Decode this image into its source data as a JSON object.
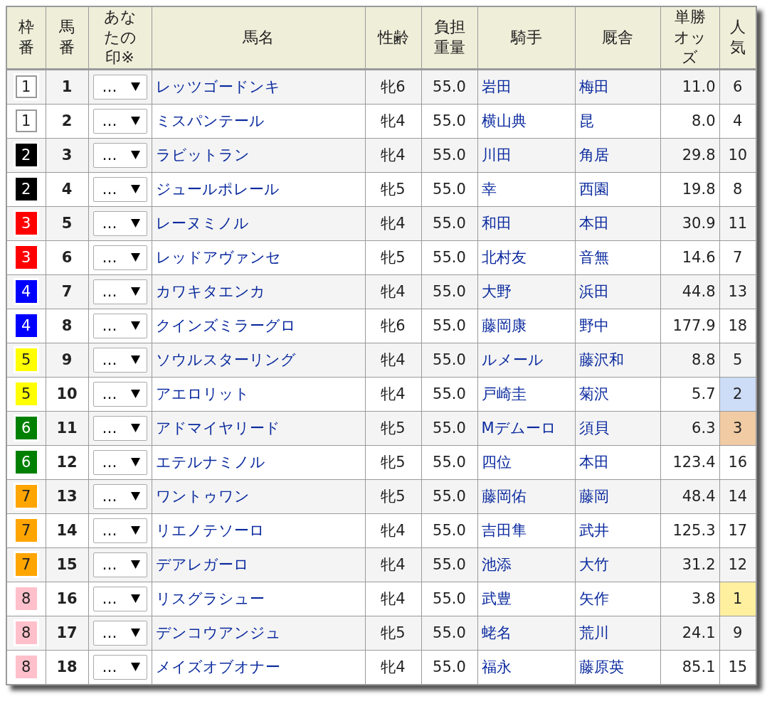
{
  "table": {
    "columns": [
      "枠番",
      "馬番",
      "あなたの印※",
      "馬名",
      "性齢",
      "負担重量",
      "騎手",
      "厩舎",
      "単勝オッズ",
      "人気"
    ],
    "rows": [
      {
        "frame": {
          "number": "1",
          "color": "#ffffff"
        },
        "horse_number": "1",
        "mark": "…",
        "horse": "レッツゴードンキ",
        "sex_age": "牝6",
        "weight": "55.0",
        "jockey": "岩田",
        "trainer": "梅田",
        "odds": "11.0",
        "popularity": {
          "text": "6"
        }
      },
      {
        "frame": {
          "number": "1",
          "color": "#ffffff"
        },
        "horse_number": "2",
        "mark": "…",
        "horse": "ミスパンテール",
        "sex_age": "牝4",
        "weight": "55.0",
        "jockey": "横山典",
        "trainer": "昆",
        "odds": "8.0",
        "popularity": {
          "text": "4"
        }
      },
      {
        "frame": {
          "number": "2",
          "color": "#000000"
        },
        "horse_number": "3",
        "mark": "…",
        "horse": "ラビットラン",
        "sex_age": "牝4",
        "weight": "55.0",
        "jockey": "川田",
        "trainer": "角居",
        "odds": "29.8",
        "popularity": {
          "text": "10"
        }
      },
      {
        "frame": {
          "number": "2",
          "color": "#000000"
        },
        "horse_number": "4",
        "mark": "…",
        "horse": "ジュールポレール",
        "sex_age": "牝5",
        "weight": "55.0",
        "jockey": "幸",
        "trainer": "西園",
        "odds": "19.8",
        "popularity": {
          "text": "8"
        }
      },
      {
        "frame": {
          "number": "3",
          "color": "#ff0000"
        },
        "horse_number": "5",
        "mark": "…",
        "horse": "レーヌミノル",
        "sex_age": "牝4",
        "weight": "55.0",
        "jockey": "和田",
        "trainer": "本田",
        "odds": "30.9",
        "popularity": {
          "text": "11"
        }
      },
      {
        "frame": {
          "number": "3",
          "color": "#ff0000"
        },
        "horse_number": "6",
        "mark": "…",
        "horse": "レッドアヴァンセ",
        "sex_age": "牝5",
        "weight": "55.0",
        "jockey": "北村友",
        "trainer": "音無",
        "odds": "14.6",
        "popularity": {
          "text": "7"
        }
      },
      {
        "frame": {
          "number": "4",
          "color": "#0000ff"
        },
        "horse_number": "7",
        "mark": "…",
        "horse": "カワキタエンカ",
        "sex_age": "牝4",
        "weight": "55.0",
        "jockey": "大野",
        "trainer": "浜田",
        "odds": "44.8",
        "popularity": {
          "text": "13"
        }
      },
      {
        "frame": {
          "number": "4",
          "color": "#0000ff"
        },
        "horse_number": "8",
        "mark": "…",
        "horse": "クインズミラーグロ",
        "sex_age": "牝6",
        "weight": "55.0",
        "jockey": "藤岡康",
        "trainer": "野中",
        "odds": "177.9",
        "popularity": {
          "text": "18"
        }
      },
      {
        "frame": {
          "number": "5",
          "color": "#ffff00"
        },
        "horse_number": "9",
        "mark": "…",
        "horse": "ソウルスターリング",
        "sex_age": "牝4",
        "weight": "55.0",
        "jockey": "ルメール",
        "trainer": "藤沢和",
        "odds": "8.8",
        "popularity": {
          "text": "5"
        }
      },
      {
        "frame": {
          "number": "5",
          "color": "#ffff00"
        },
        "horse_number": "10",
        "mark": "…",
        "horse": "アエロリット",
        "sex_age": "牝4",
        "weight": "55.0",
        "jockey": "戸崎圭",
        "trainer": "菊沢",
        "odds": "5.7",
        "popularity": {
          "text": "2",
          "color": "#cddcf7"
        }
      },
      {
        "frame": {
          "number": "6",
          "color": "#008000"
        },
        "horse_number": "11",
        "mark": "…",
        "horse": "アドマイヤリード",
        "sex_age": "牝5",
        "weight": "55.0",
        "jockey": "Mデムーロ",
        "trainer": "須貝",
        "odds": "6.3",
        "popularity": {
          "text": "3",
          "color": "#f0cba3"
        }
      },
      {
        "frame": {
          "number": "6",
          "color": "#008000"
        },
        "horse_number": "12",
        "mark": "…",
        "horse": "エテルナミノル",
        "sex_age": "牝5",
        "weight": "55.0",
        "jockey": "四位",
        "trainer": "本田",
        "odds": "123.4",
        "popularity": {
          "text": "16"
        }
      },
      {
        "frame": {
          "number": "7",
          "color": "#ffa500"
        },
        "horse_number": "13",
        "mark": "…",
        "horse": "ワントゥワン",
        "sex_age": "牝5",
        "weight": "55.0",
        "jockey": "藤岡佑",
        "trainer": "藤岡",
        "odds": "48.4",
        "popularity": {
          "text": "14"
        }
      },
      {
        "frame": {
          "number": "7",
          "color": "#ffa500"
        },
        "horse_number": "14",
        "mark": "…",
        "horse": "リエノテソーロ",
        "sex_age": "牝4",
        "weight": "55.0",
        "jockey": "吉田隼",
        "trainer": "武井",
        "odds": "125.3",
        "popularity": {
          "text": "17"
        }
      },
      {
        "frame": {
          "number": "7",
          "color": "#ffa500"
        },
        "horse_number": "15",
        "mark": "…",
        "horse": "デアレガーロ",
        "sex_age": "牝4",
        "weight": "55.0",
        "jockey": "池添",
        "trainer": "大竹",
        "odds": "31.2",
        "popularity": {
          "text": "12"
        }
      },
      {
        "frame": {
          "number": "8",
          "color": "#ffc0cb"
        },
        "horse_number": "16",
        "mark": "…",
        "horse": "リスグラシュー",
        "sex_age": "牝4",
        "weight": "55.0",
        "jockey": "武豊",
        "trainer": "矢作",
        "odds": "3.8",
        "popularity": {
          "text": "1",
          "color": "#fff0a0"
        }
      },
      {
        "frame": {
          "number": "8",
          "color": "#ffc0cb"
        },
        "horse_number": "17",
        "mark": "…",
        "horse": "デンコウアンジュ",
        "sex_age": "牝5",
        "weight": "55.0",
        "jockey": "蛯名",
        "trainer": "荒川",
        "odds": "24.1",
        "popularity": {
          "text": "9"
        }
      },
      {
        "frame": {
          "number": "8",
          "color": "#ffc0cb"
        },
        "horse_number": "18",
        "mark": "…",
        "horse": "メイズオブオナー",
        "sex_age": "牝4",
        "weight": "55.0",
        "jockey": "福永",
        "trainer": "藤原英",
        "odds": "85.1",
        "popularity": {
          "text": "15"
        }
      }
    ]
  }
}
